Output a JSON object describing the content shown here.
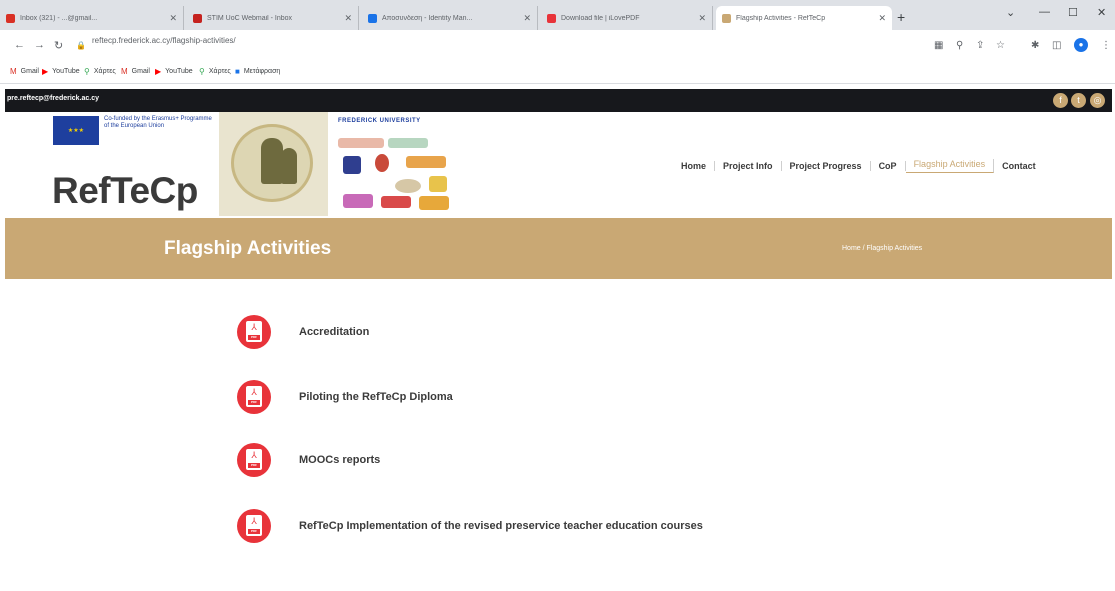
{
  "browser": {
    "tabs": [
      {
        "title": "Inbox (321) - ...@gmail...",
        "fav_color": "#d93025"
      },
      {
        "title": "STIM UoC Webmail - Inbox",
        "fav_color": "#c5221f"
      },
      {
        "title": "Αποσυνδεση - Identity Man...",
        "fav_color": "#1a73e8"
      },
      {
        "title": "Download file | iLovePDF",
        "fav_color": "#e8333a"
      },
      {
        "title": "Flagship Activities - RefTeCp",
        "fav_color": "#c9a874"
      }
    ],
    "url": "reftecp.frederick.ac.cy/flagship-activities/",
    "bookmarks": [
      {
        "label": "Gmail",
        "icon": "gmail-icon",
        "icon_char": "M",
        "color": "#d93025"
      },
      {
        "label": "YouTube",
        "icon": "youtube-icon",
        "icon_char": "▶",
        "color": "#ff0000"
      },
      {
        "label": "Χάρτες",
        "icon": "maps-icon",
        "icon_char": "⚲",
        "color": "#34a853"
      },
      {
        "label": "Gmail",
        "icon": "gmail-icon",
        "icon_char": "M",
        "color": "#d93025"
      },
      {
        "label": "YouTube",
        "icon": "youtube-icon",
        "icon_char": "▶",
        "color": "#ff0000"
      },
      {
        "label": "Χάρτες",
        "icon": "maps-icon",
        "icon_char": "⚲",
        "color": "#34a853"
      },
      {
        "label": "Μετάφραση",
        "icon": "translate-icon",
        "icon_char": "■",
        "color": "#1a73e8"
      }
    ]
  },
  "site": {
    "email": "pre.reftecp@frederick.ac.cy",
    "eu_text": "Co-funded by the Erasmus+ Programme of the European Union",
    "logo_text": "RefTeCp",
    "partner_name": "FREDERICK UNIVERSITY",
    "nav": [
      {
        "label": "Home",
        "active": false
      },
      {
        "label": "Project Info",
        "active": false
      },
      {
        "label": "Project Progress",
        "active": false
      },
      {
        "label": "CoP",
        "active": false
      },
      {
        "label": "Flagship Activities",
        "active": true
      },
      {
        "label": "Contact",
        "active": false
      }
    ],
    "banner_title": "Flagship Activities",
    "breadcrumb": "Home / Flagship Activities",
    "accent": "#c9a874",
    "pdf_red": "#e8333a"
  },
  "documents": [
    {
      "title": "Accreditation"
    },
    {
      "title": "Piloting the RefTeCp Diploma"
    },
    {
      "title": "MOOCs reports"
    },
    {
      "title": "RefTeCp Implementation of the revised preservice teacher education courses"
    }
  ]
}
